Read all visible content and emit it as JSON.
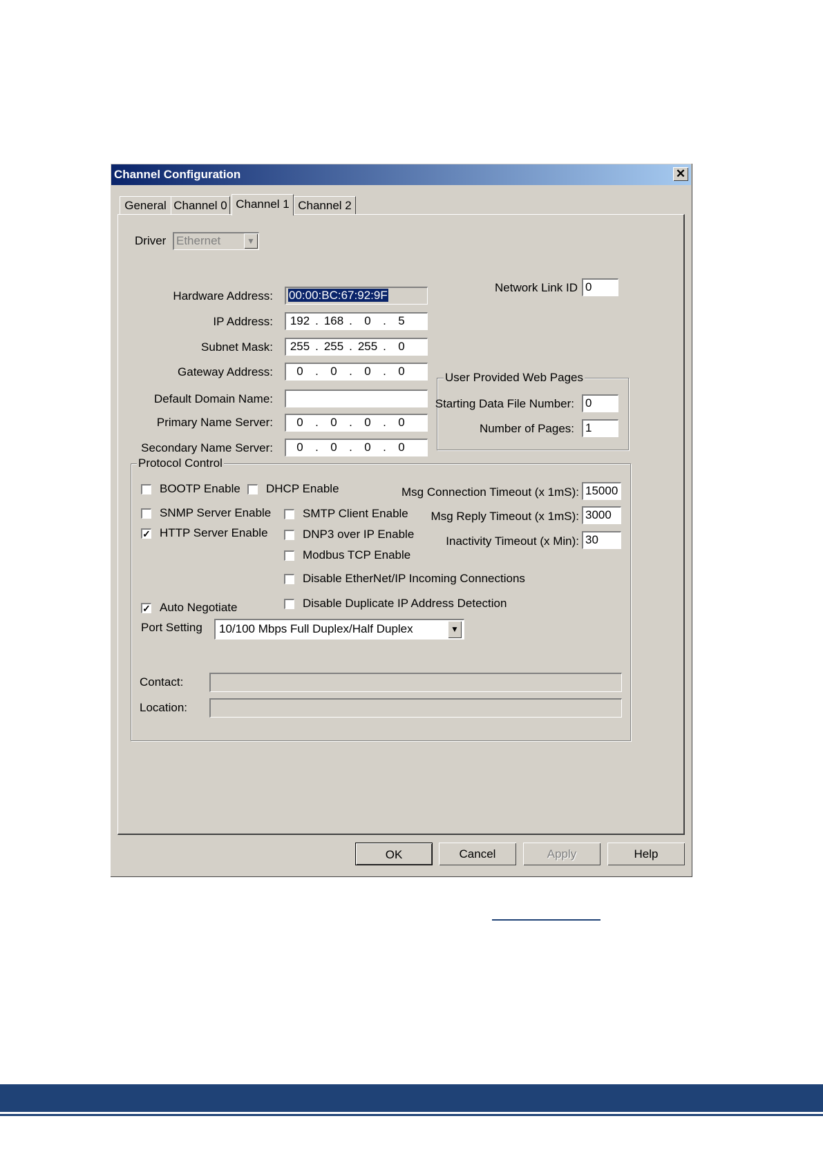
{
  "dialog": {
    "title": "Channel Configuration",
    "close_symbol": "✕"
  },
  "tabs": [
    {
      "label": "General",
      "active": false
    },
    {
      "label": "Channel 0",
      "active": false
    },
    {
      "label": "Channel 1",
      "active": true
    },
    {
      "label": "Channel 2",
      "active": false
    }
  ],
  "driver": {
    "label": "Driver",
    "value": "Ethernet"
  },
  "network": {
    "hardware_address_label": "Hardware Address:",
    "hardware_address": "00:00:BC:67:92:9F",
    "ip_address_label": "IP Address:",
    "ip_address": [
      "192",
      "168",
      "0",
      "5"
    ],
    "subnet_mask_label": "Subnet Mask:",
    "subnet_mask": [
      "255",
      "255",
      "255",
      "0"
    ],
    "gateway_address_label": "Gateway Address:",
    "gateway_address": [
      "0",
      "0",
      "0",
      "0"
    ],
    "default_domain_label": "Default Domain Name:",
    "default_domain": "",
    "primary_dns_label": "Primary Name Server:",
    "primary_dns": [
      "0",
      "0",
      "0",
      "0"
    ],
    "secondary_dns_label": "Secondary Name Server:",
    "secondary_dns": [
      "0",
      "0",
      "0",
      "0"
    ],
    "network_link_id_label": "Network Link ID",
    "network_link_id": "0"
  },
  "web_pages": {
    "title": "User Provided Web Pages",
    "start_file_label": "Starting Data File Number:",
    "start_file": "0",
    "num_pages_label": "Number of Pages:",
    "num_pages": "1"
  },
  "protocol": {
    "title": "Protocol Control",
    "bootp": {
      "label": "BOOTP Enable",
      "checked": false
    },
    "dhcp": {
      "label": "DHCP Enable",
      "checked": false
    },
    "snmp": {
      "label": "SNMP Server Enable",
      "checked": false
    },
    "http": {
      "label": "HTTP Server Enable",
      "checked": true
    },
    "smtp": {
      "label": "SMTP Client Enable",
      "checked": false
    },
    "dnp3": {
      "label": "DNP3 over IP Enable",
      "checked": false
    },
    "modbus": {
      "label": "Modbus TCP Enable",
      "checked": false
    },
    "disable_enip": {
      "label": "Disable EtherNet/IP Incoming Connections",
      "checked": false
    },
    "auto_negotiate": {
      "label": "Auto Negotiate",
      "checked": true
    },
    "disable_dup_ip": {
      "label": "Disable Duplicate IP Address Detection",
      "checked": false
    },
    "msg_conn_timeout_label": "Msg Connection Timeout (x 1mS):",
    "msg_conn_timeout": "15000",
    "msg_reply_timeout_label": "Msg Reply Timeout (x 1mS):",
    "msg_reply_timeout": "3000",
    "inactivity_timeout_label": "Inactivity Timeout (x Min):",
    "inactivity_timeout": "30",
    "port_setting_label": "Port Setting",
    "port_setting": "10/100 Mbps Full Duplex/Half Duplex",
    "contact_label": "Contact:",
    "contact": "",
    "location_label": "Location:",
    "location": ""
  },
  "buttons": {
    "ok": "OK",
    "cancel": "Cancel",
    "apply": "Apply",
    "help": "Help"
  },
  "icons": {
    "check": "✓",
    "dropdown": "▼"
  },
  "colors": {
    "footer": "#1f4276",
    "title_start": "#0a246a",
    "title_end": "#a6caf0"
  }
}
